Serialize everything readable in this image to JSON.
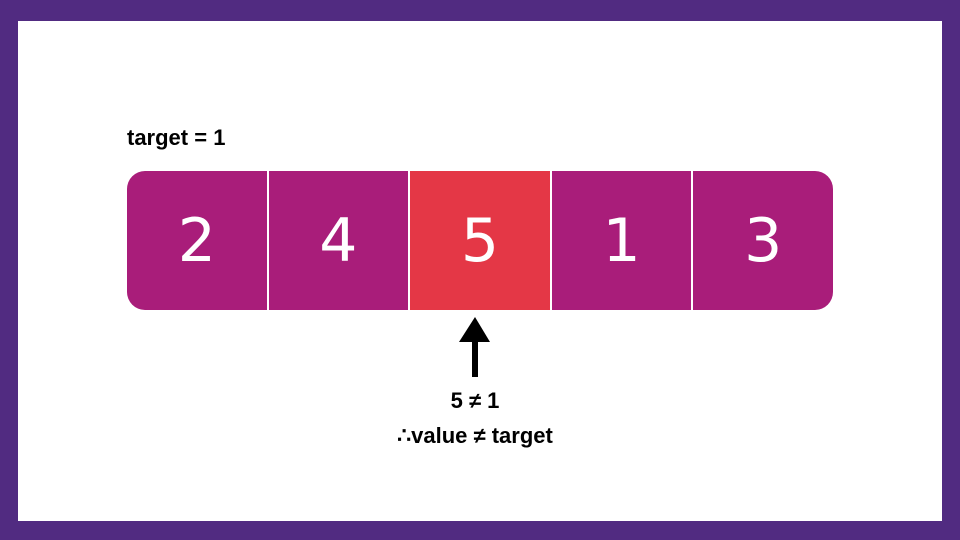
{
  "colors": {
    "frame": "#512b81",
    "cell": "#a91d7a",
    "highlight": "#e43746",
    "text": "#ffffff"
  },
  "target_label": "target = 1",
  "array": {
    "cells": [
      {
        "value": "2",
        "highlighted": false
      },
      {
        "value": "4",
        "highlighted": false
      },
      {
        "value": "5",
        "highlighted": true
      },
      {
        "value": "1",
        "highlighted": false
      },
      {
        "value": "3",
        "highlighted": false
      }
    ]
  },
  "pointer_icon": "arrow-up-icon",
  "comparison": {
    "line1": "5 ≠ 1",
    "line2": "∴value ≠ target"
  }
}
